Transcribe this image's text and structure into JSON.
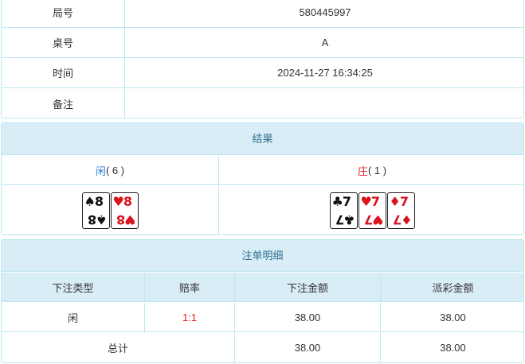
{
  "info": {
    "rows": [
      {
        "label": "局号",
        "value": "580445997"
      },
      {
        "label": "桌号",
        "value": "A"
      },
      {
        "label": "时间",
        "value": "2024-11-27 16:34:25"
      },
      {
        "label": "备注",
        "value": ""
      }
    ]
  },
  "result": {
    "title": "结果",
    "player": {
      "name": "闲",
      "score": "( 6 )",
      "cards": [
        {
          "suit": "♠",
          "rank": "8",
          "color": "black"
        },
        {
          "suit": "♥",
          "rank": "8",
          "color": "red"
        }
      ]
    },
    "banker": {
      "name": "庄",
      "score": "( 1 )",
      "cards": [
        {
          "suit": "♣",
          "rank": "7",
          "color": "black"
        },
        {
          "suit": "♥",
          "rank": "7",
          "color": "red"
        },
        {
          "suit": "♦",
          "rank": "7",
          "color": "red"
        }
      ]
    }
  },
  "bets": {
    "title": "注单明细",
    "headers": [
      "下注类型",
      "赔率",
      "下注金额",
      "派彩金额"
    ],
    "rows": [
      {
        "type": "闲",
        "odds": "1:1",
        "amount": "38.00",
        "payout": "38.00"
      }
    ],
    "total": {
      "label": "总计",
      "amount": "38.00",
      "payout": "38.00"
    }
  },
  "colors": {
    "border": "#bce8f1",
    "header_bg": "#d9edf7",
    "header_text": "#31708f",
    "player": "#2a7ed0",
    "banker": "#e02020",
    "card_red": "#d8141c"
  }
}
